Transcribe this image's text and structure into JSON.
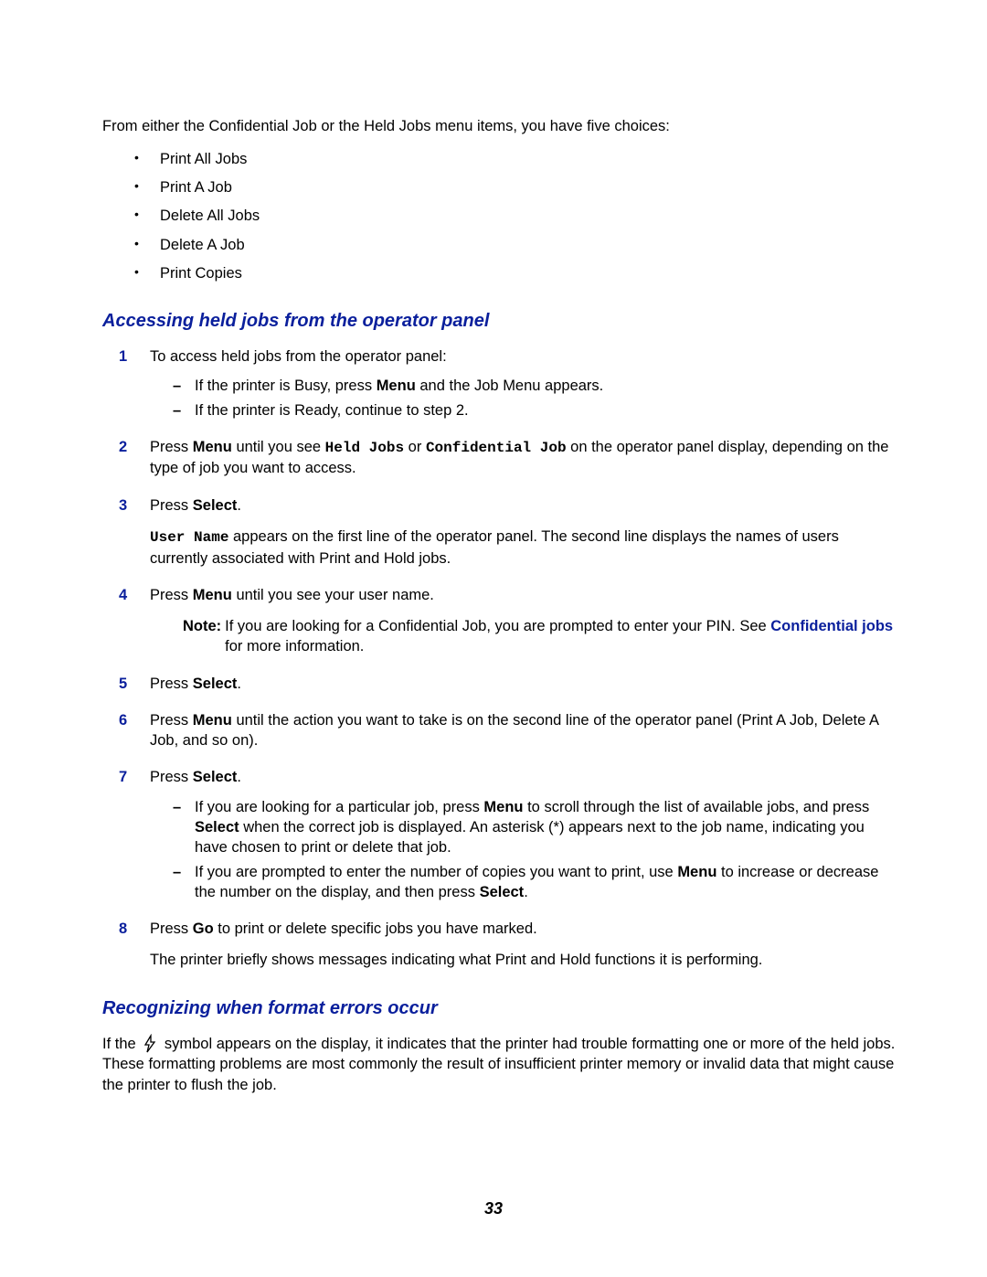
{
  "intro": "From either the Confidential Job or the Held Jobs menu items, you have five choices:",
  "bullets": [
    "Print All Jobs",
    "Print A Job",
    "Delete All Jobs",
    "Delete A Job",
    "Print Copies"
  ],
  "heading1": "Accessing held jobs from the operator panel",
  "step1_text": "To access held jobs from the operator panel:",
  "step1_sub": [
    "If the printer is Busy, press <b>Menu</b> and the Job Menu appears.",
    "If the printer is Ready, continue to step 2."
  ],
  "step2_text": "Press <b>Menu</b> until you see <span class=\"code\">Held Jobs</span> or <span class=\"code\">Confidential Job</span> on the operator panel display, depending on the type of job you want to access.",
  "step3_text": "Press <b>Select</b>.",
  "step3_follow": "<span class=\"code\">User Name</span> appears on the first line of the operator panel. The second line displays the names of users currently associated with Print and Hold jobs.",
  "step4_text": "Press <b>Menu</b> until you see your user name.",
  "note_label": "Note:",
  "note_text": "If you are looking for a Confidential Job, you are prompted to enter your PIN. See <span class=\"link\">Confidential jobs</span> for more information.",
  "step5_text": "Press <b>Select</b>.",
  "step6_text": "Press <b>Menu</b> until the action you want to take is on the second line of the operator panel (Print A Job, Delete A Job, and so on).",
  "step7_text": "Press <b>Select</b>.",
  "step7_sub": [
    "If you are looking for a particular job, press <b>Menu</b> to scroll through the list of available jobs, and press <b>Select</b> when the correct job is displayed. An asterisk (*) appears next to the job name, indicating you have chosen to print or delete that job.",
    "If you are prompted to enter the number of copies you want to print, use <b>Menu</b> to increase or decrease the number on the display, and then press <b>Select</b>."
  ],
  "step8_text": "Press <b>Go</b> to print or delete specific jobs you have marked.",
  "step8_follow": "The printer briefly shows messages indicating what Print and Hold functions it is performing.",
  "heading2": "Recognizing when format errors occur",
  "errors_para_pre": "If the ",
  "errors_para_post": " symbol appears on the display, it indicates that the printer had trouble formatting one or more of the held jobs. These formatting problems are most commonly the result of insufficient printer memory or invalid data that might cause the printer to flush the job.",
  "page_number": "33"
}
